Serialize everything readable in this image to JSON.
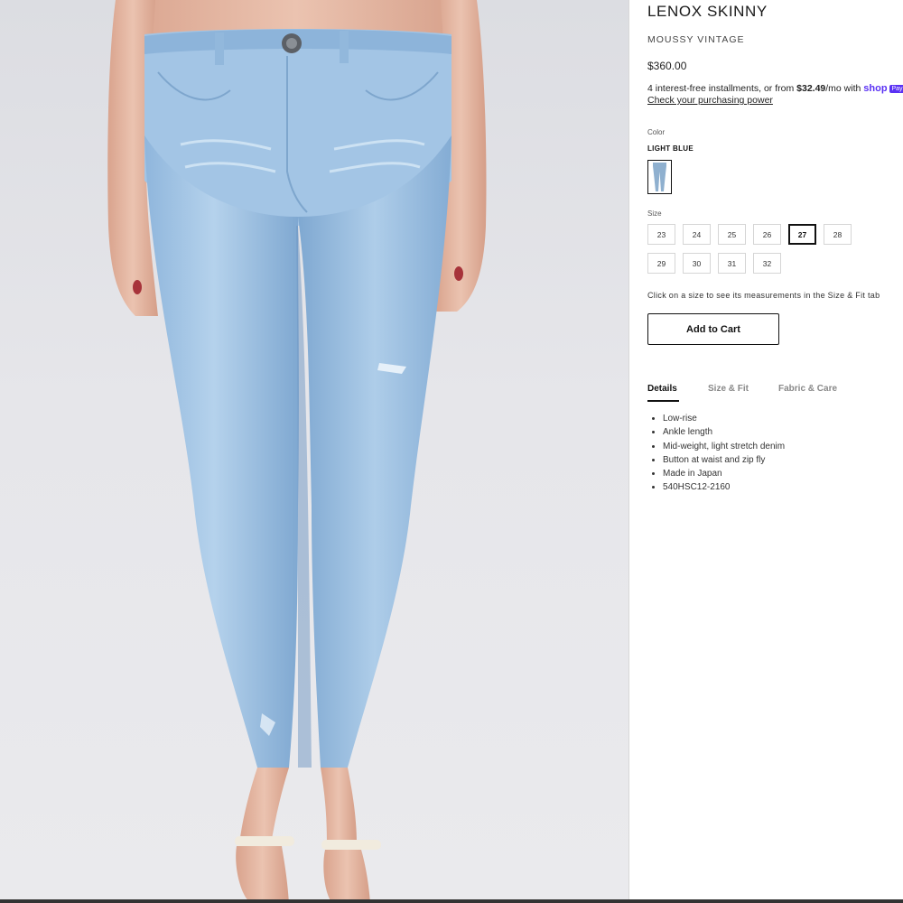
{
  "product": {
    "title": "LENOX SKINNY",
    "brand": "MOUSSY VINTAGE",
    "price": "$360.00"
  },
  "installments": {
    "prefix": "4 interest-free installments, or from ",
    "amount": "$32.49",
    "suffix": "/mo with ",
    "provider": "shop",
    "badge": "Pay",
    "link_label": "Check your purchasing power"
  },
  "color": {
    "label": "Color",
    "selected": "LIGHT BLUE",
    "swatch_color": "#8fb0cf"
  },
  "size": {
    "label": "Size",
    "options": [
      "23",
      "24",
      "25",
      "26",
      "27",
      "28",
      "29",
      "30",
      "31",
      "32"
    ],
    "selected": "27",
    "hint": "Click on a size to see its measurements in the Size & Fit tab"
  },
  "cart": {
    "label": "Add to Cart"
  },
  "tabs": [
    {
      "label": "Details",
      "active": true
    },
    {
      "label": "Size & Fit",
      "active": false
    },
    {
      "label": "Fabric & Care",
      "active": false
    }
  ],
  "details": [
    "Low-rise",
    "Ankle length",
    "Mid-weight, light stretch denim",
    "Button at waist and zip fly",
    "Made in Japan",
    "540HSC12-2160"
  ],
  "colors": {
    "denim_light": "#9ec3e3",
    "denim_mid": "#7fa8d1",
    "denim_dark": "#6e96c2",
    "skin": "#e2b4a0",
    "shoe_strap": "#f1ebde",
    "shop_pay": "#5a31f4"
  }
}
